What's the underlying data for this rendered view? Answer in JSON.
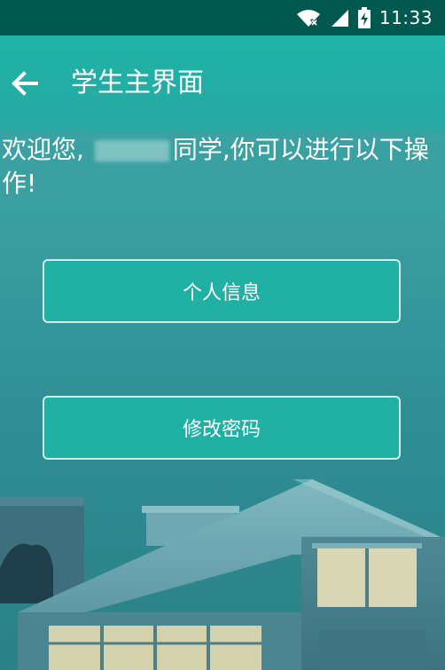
{
  "status_bar": {
    "time": "11:33",
    "icons": [
      "wifi-icon",
      "signal-icon",
      "battery-charging-icon"
    ]
  },
  "app_bar": {
    "title": "学生主界面",
    "back_icon": "arrow-left-icon"
  },
  "welcome": {
    "prefix": "欢迎您,",
    "suffix": "同学,你可以进行以下操作!"
  },
  "actions": {
    "personal_info_label": "个人信息",
    "change_password_label": "修改密码"
  },
  "colors": {
    "status_bar": "#00584e",
    "app_bar": "#1fb3a6",
    "button": "#20b0a4"
  }
}
